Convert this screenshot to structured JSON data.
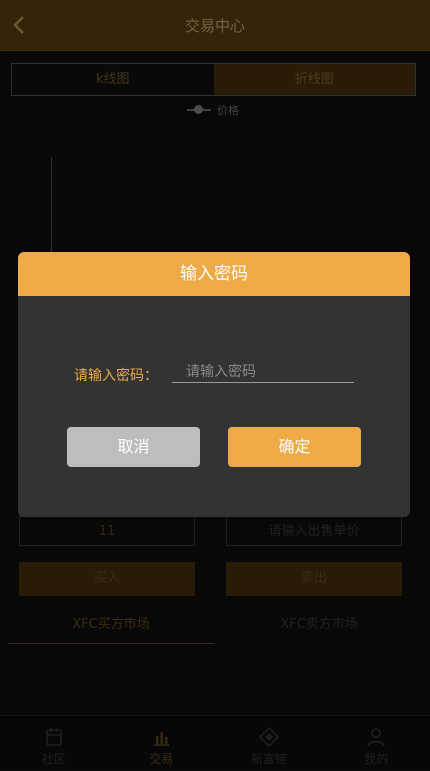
{
  "header": {
    "title": "交易中心"
  },
  "chart_tabs": {
    "kline": "k线图",
    "line": "折线图"
  },
  "legend": {
    "price": "价格"
  },
  "form": {
    "buy_price_value": "11",
    "sell_price_placeholder": "请输入出售单价",
    "buy_button": "买入",
    "sell_button": "卖出"
  },
  "market_tabs": {
    "buy": "XFC买方市场",
    "sell": "XFC卖方市场"
  },
  "bottom_nav": {
    "items": [
      {
        "label": "社区",
        "icon": "community-icon"
      },
      {
        "label": "交易",
        "icon": "trade-chart-icon",
        "active": true
      },
      {
        "label": "新富链",
        "icon": "chain-icon"
      },
      {
        "label": "我的",
        "icon": "user-icon"
      }
    ]
  },
  "dialog": {
    "title": "输入密码",
    "label": "请输入密码：",
    "placeholder": "请输入密码",
    "cancel": "取消",
    "confirm": "确定"
  },
  "colors": {
    "accent": "#edaa46",
    "header": "#5e4313",
    "dialog_bg": "#333333"
  }
}
